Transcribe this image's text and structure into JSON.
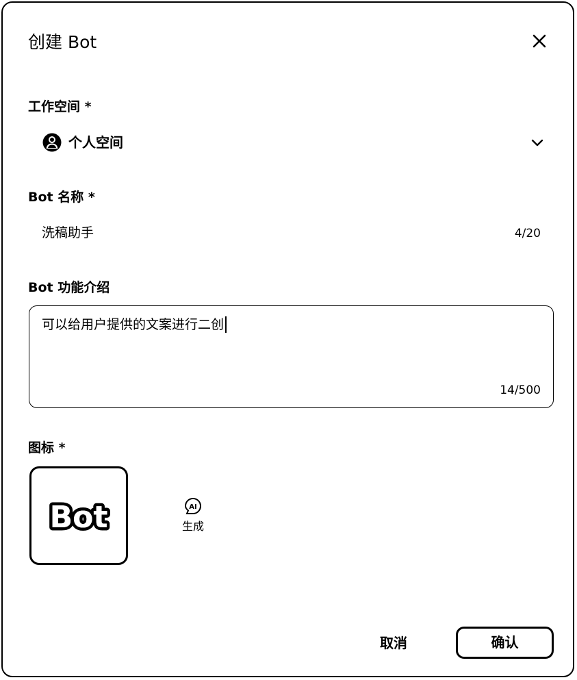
{
  "dialog": {
    "title": "创建 Bot",
    "close_icon": "close-icon"
  },
  "workspace": {
    "label": "工作空间 *",
    "selected": "个人空间",
    "avatar_icon": "user-avatar-icon",
    "chevron_icon": "chevron-down-icon"
  },
  "bot_name": {
    "label": "Bot 名称 *",
    "value": "洗稿助手",
    "counter": "4/20"
  },
  "bot_description": {
    "label": "Bot 功能介绍",
    "value": "可以给用户提供的文案进行二创",
    "counter": "14/500"
  },
  "icon_section": {
    "label": "图标 *",
    "tile_text": "Bot",
    "ai_badge_text": "AI",
    "ai_generate_label": "生成"
  },
  "footer": {
    "cancel_label": "取消",
    "confirm_label": "确认"
  }
}
